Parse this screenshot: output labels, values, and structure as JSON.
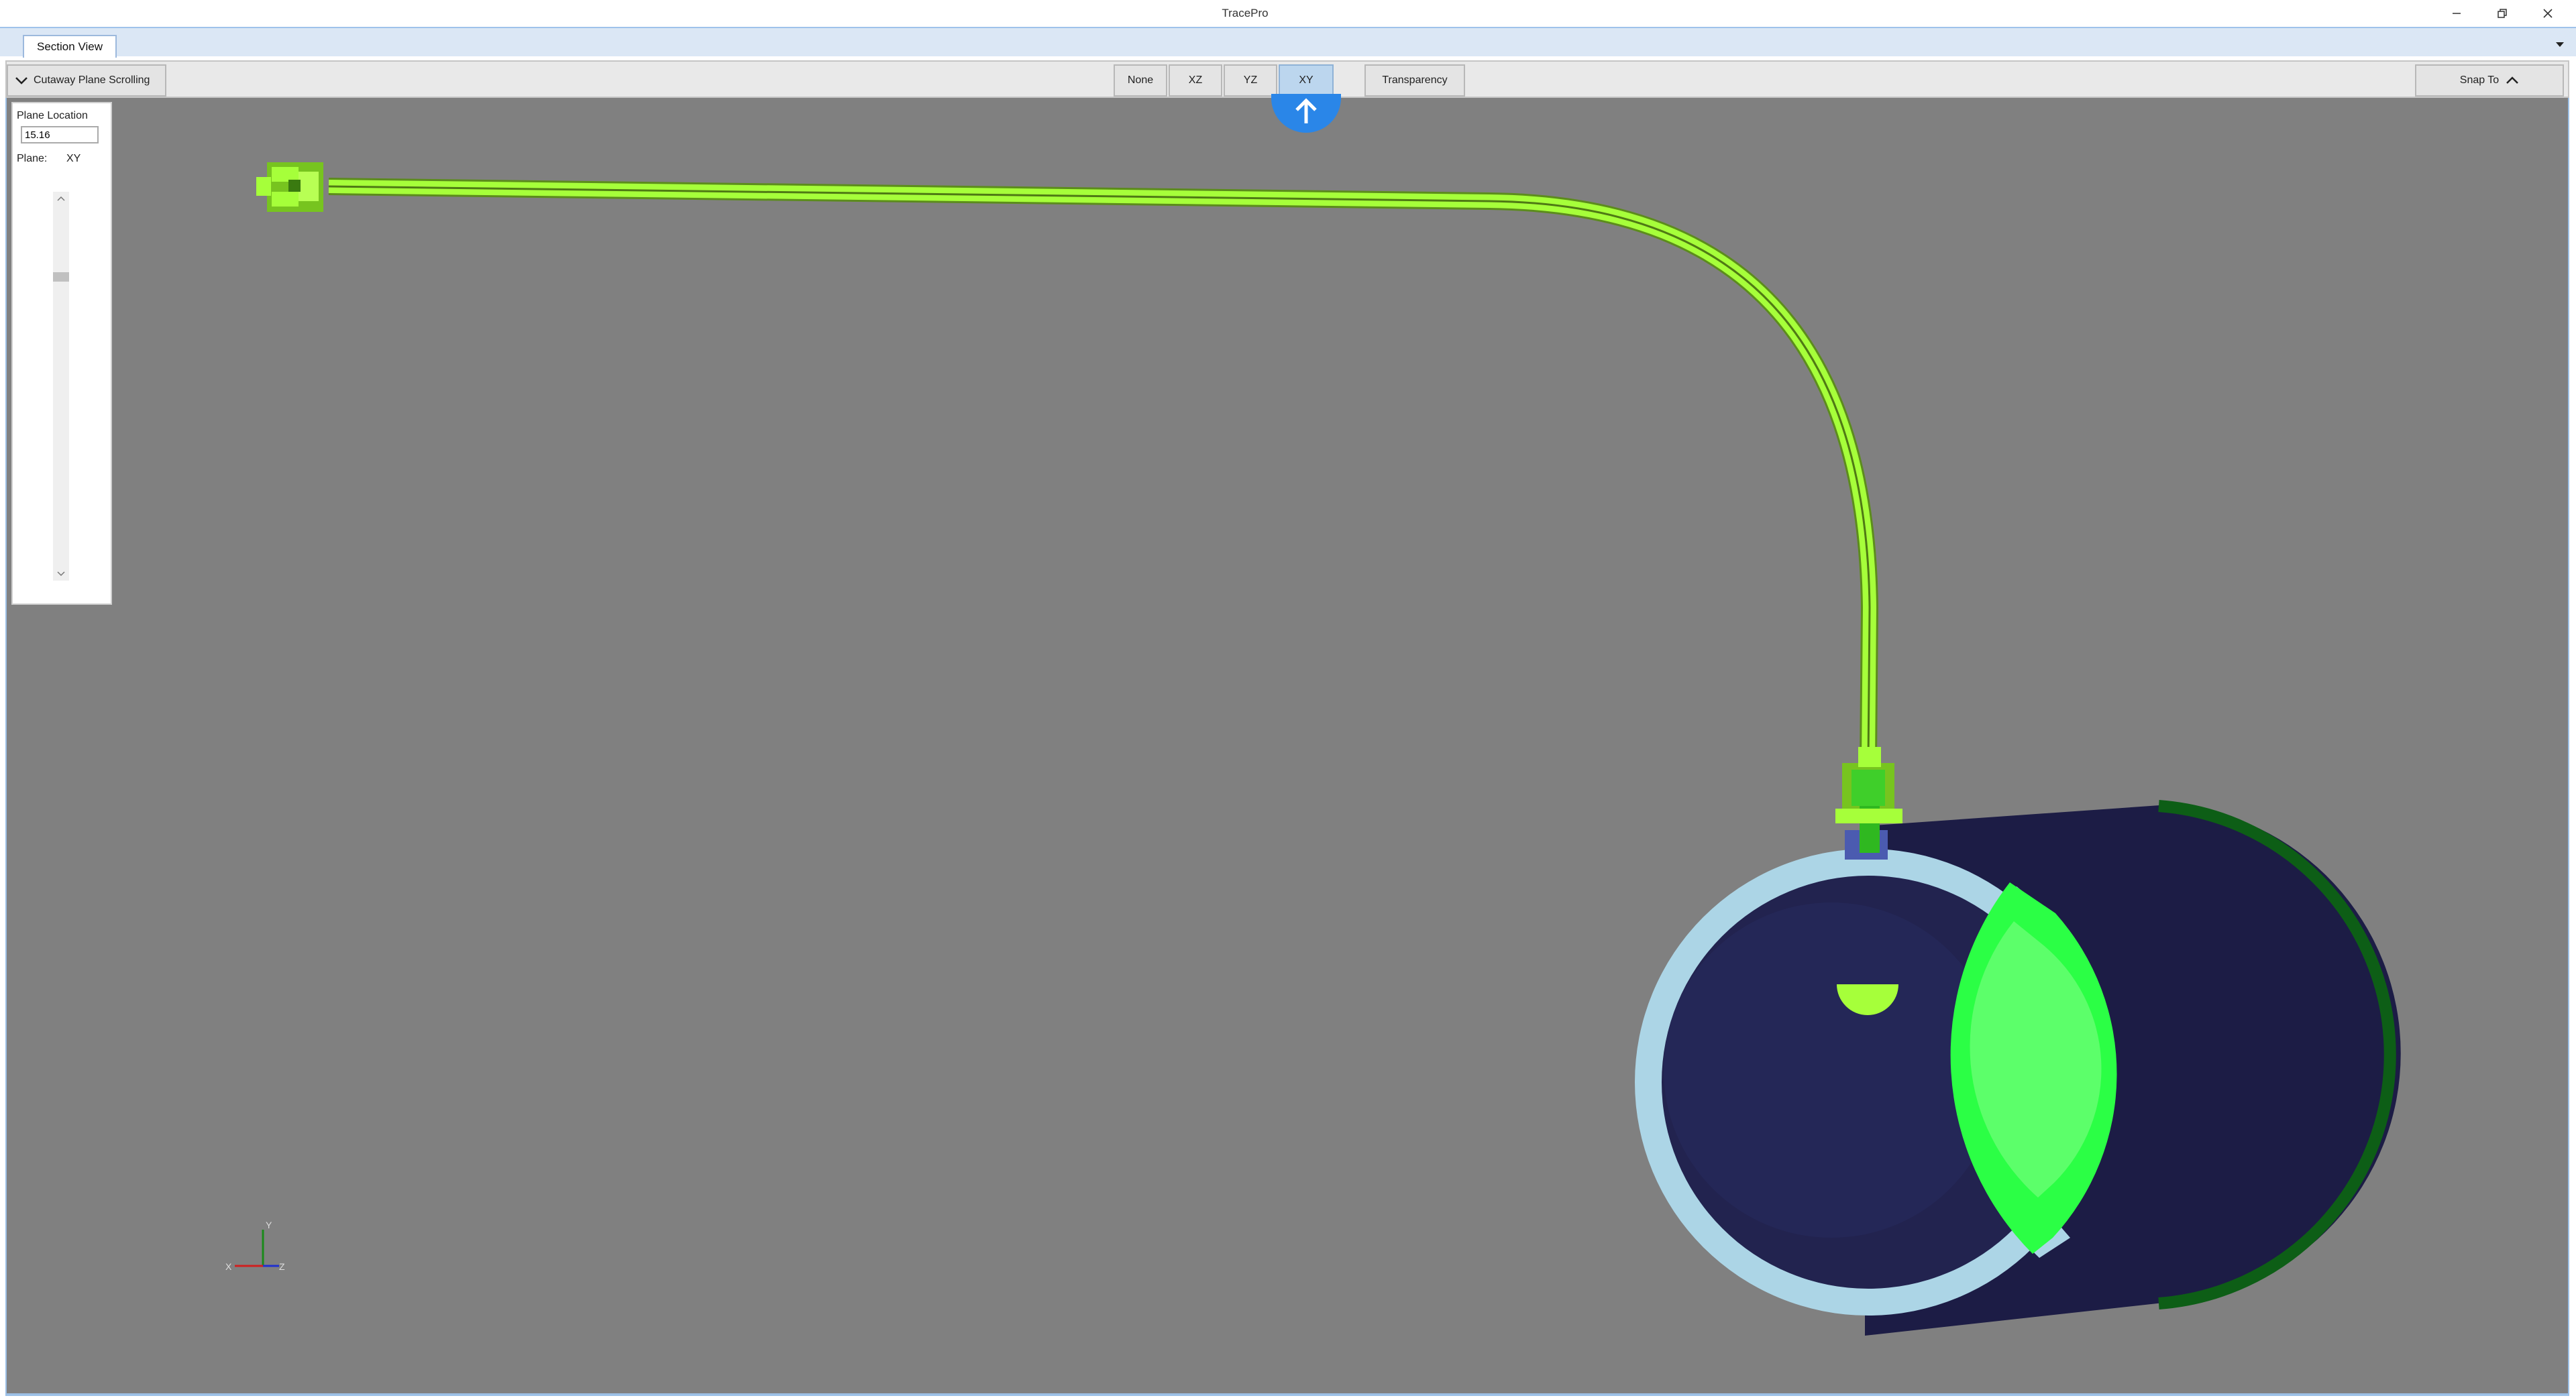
{
  "window": {
    "title": "TracePro"
  },
  "tabs": [
    {
      "label": "Section View",
      "active": true
    }
  ],
  "toolbar": {
    "cutaway_label": "Cutaway Plane Scrolling",
    "planes": [
      {
        "label": "None",
        "active": false
      },
      {
        "label": "XZ",
        "active": false
      },
      {
        "label": "YZ",
        "active": false
      },
      {
        "label": "XY",
        "active": true
      }
    ],
    "transparency_label": "Transparency",
    "snap_to_label": "Snap To"
  },
  "plane_panel": {
    "location_label": "Plane Location",
    "location_value": "15.16",
    "plane_label": "Plane:",
    "plane_value": "XY"
  },
  "axis_triad": {
    "x_label": "X",
    "y_label": "Y",
    "z_label": "Z"
  },
  "colors": {
    "accent_blue": "#2a86e8",
    "viewport_gray": "#808080",
    "tube_green": "#a6ff3a",
    "housing_navy": "#1c1c45",
    "ring_lightblue": "#acd5e6",
    "lens_green": "#2bff45"
  },
  "icons": {
    "up_arrow": "arrow-up-icon",
    "collapse": "chevron-down-icon",
    "snap": "chevron-up-icon"
  }
}
